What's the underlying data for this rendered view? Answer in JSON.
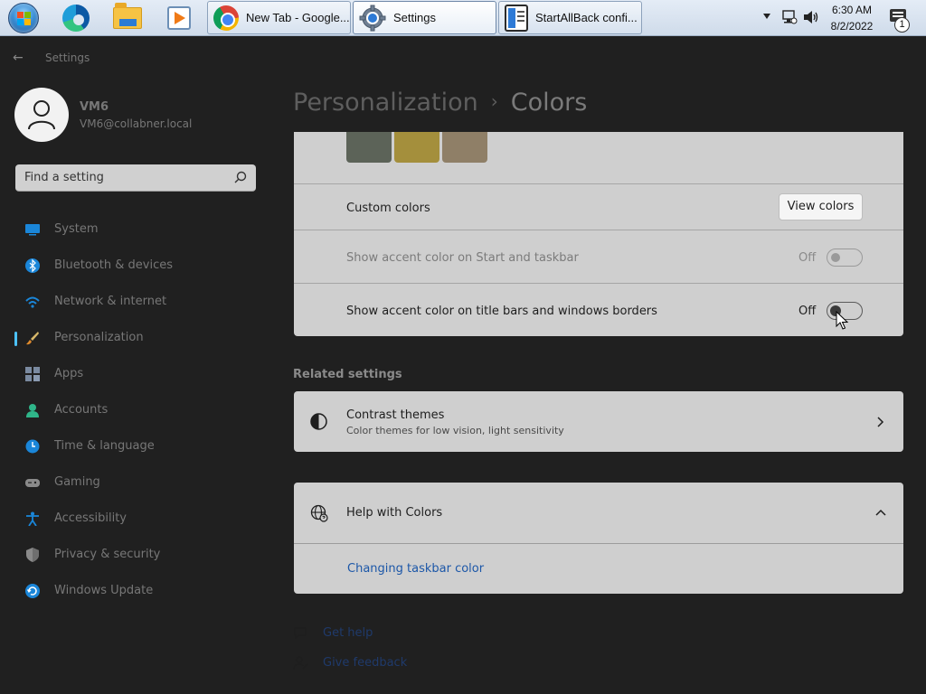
{
  "taskbar": {
    "tasks": [
      {
        "label": "New Tab - Google...",
        "icon": "chrome-icon"
      },
      {
        "label": "Settings",
        "icon": "settings-gear-icon"
      },
      {
        "label": "StartAllBack confi...",
        "icon": "startallback-icon"
      }
    ],
    "clock": {
      "time": "6:30 AM",
      "date": "8/2/2022"
    },
    "notification_count": "1"
  },
  "window": {
    "title": "Settings"
  },
  "user": {
    "name": "VM6",
    "email": "VM6@collabner.local"
  },
  "search": {
    "placeholder": "Find a setting"
  },
  "nav": {
    "items": [
      {
        "label": "System",
        "icon": "system-icon"
      },
      {
        "label": "Bluetooth & devices",
        "icon": "bluetooth-icon"
      },
      {
        "label": "Network & internet",
        "icon": "wifi-icon"
      },
      {
        "label": "Personalization",
        "icon": "brush-icon",
        "selected": true
      },
      {
        "label": "Apps",
        "icon": "apps-icon"
      },
      {
        "label": "Accounts",
        "icon": "accounts-icon"
      },
      {
        "label": "Time & language",
        "icon": "clock-icon"
      },
      {
        "label": "Gaming",
        "icon": "gamepad-icon"
      },
      {
        "label": "Accessibility",
        "icon": "accessibility-icon"
      },
      {
        "label": "Privacy & security",
        "icon": "shield-icon"
      },
      {
        "label": "Windows Update",
        "icon": "update-icon"
      }
    ]
  },
  "header": {
    "crumb_parent": "Personalization",
    "separator": "›",
    "crumb_current": "Colors"
  },
  "colors_card": {
    "swatches": [
      "#5c6358",
      "#a48f3c",
      "#8f7f67"
    ],
    "custom_colors_label": "Custom colors",
    "view_colors_button": "View colors",
    "start_taskbar_label": "Show accent color on Start and taskbar",
    "start_taskbar_state": "Off",
    "title_bars_label": "Show accent color on title bars and windows borders",
    "title_bars_state": "Off"
  },
  "related": {
    "heading": "Related settings",
    "contrast_title": "Contrast themes",
    "contrast_subtitle": "Color themes for low vision, light sensitivity"
  },
  "help": {
    "title": "Help with Colors",
    "link": "Changing taskbar color"
  },
  "footer": {
    "get_help": "Get help",
    "give_feedback": "Give feedback"
  },
  "colors": {
    "accent": "#4cc2ff",
    "card_bg": "#cfcfcf",
    "page_bg": "#202020",
    "link": "#1c57a8"
  }
}
